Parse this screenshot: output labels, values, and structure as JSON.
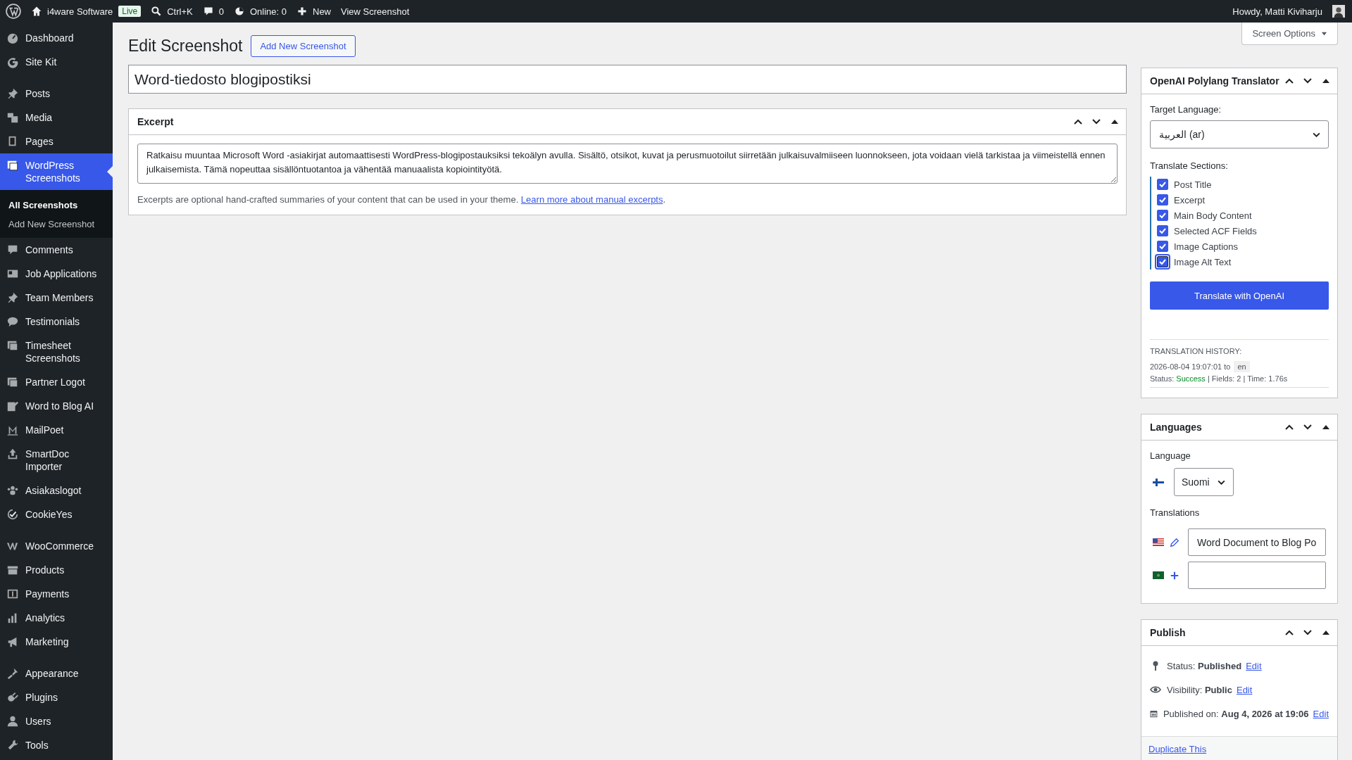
{
  "admin_bar": {
    "site": "i4ware Software",
    "badge": "Live",
    "search": "Ctrl+K",
    "comments": "0",
    "online": "Online: 0",
    "new": "New",
    "view": "View Screenshot",
    "greeting": "Howdy, Matti Kiviharju"
  },
  "sidebar": {
    "groups": [
      [
        {
          "label": "Dashboard",
          "selected": false
        },
        {
          "label": "Site Kit",
          "selected": false
        }
      ],
      [
        {
          "label": "Posts",
          "selected": false
        },
        {
          "label": "Media",
          "selected": false
        },
        {
          "label": "Pages",
          "selected": false
        },
        {
          "label": "WordPress Screenshots",
          "selected": true,
          "children": [
            {
              "label": "All Screenshots",
              "selected": true
            },
            {
              "label": "Add New Screenshot",
              "selected": false
            }
          ]
        },
        {
          "label": "Comments",
          "selected": false
        },
        {
          "label": "Job Applications",
          "selected": false
        },
        {
          "label": "Team Members",
          "selected": false
        },
        {
          "label": "Testimonials",
          "selected": false
        },
        {
          "label": "Timesheet Screenshots",
          "selected": false
        },
        {
          "label": "Partner Logot",
          "selected": false
        },
        {
          "label": "Word to Blog AI",
          "selected": false
        },
        {
          "label": "MailPoet",
          "selected": false
        },
        {
          "label": "SmartDoc Importer",
          "selected": false
        },
        {
          "label": "Asiakaslogot",
          "selected": false
        },
        {
          "label": "CookieYes",
          "selected": false
        }
      ],
      [
        {
          "label": "WooCommerce",
          "selected": false
        },
        {
          "label": "Products",
          "selected": false
        },
        {
          "label": "Payments",
          "selected": false
        },
        {
          "label": "Analytics",
          "selected": false
        },
        {
          "label": "Marketing",
          "selected": false
        }
      ],
      [
        {
          "label": "Appearance",
          "selected": false
        },
        {
          "label": "Plugins",
          "selected": false
        },
        {
          "label": "Users",
          "selected": false
        },
        {
          "label": "Tools",
          "selected": false
        }
      ]
    ]
  },
  "screen_options": "Screen Options",
  "heading": "Edit Screenshot",
  "add_new": "Add New Screenshot",
  "title_field": {
    "value": "Word-tiedosto blogipostiksi"
  },
  "excerpt": {
    "title": "Excerpt",
    "value": "Ratkaisu muuntaa Microsoft Word -asiakirjat automaattisesti WordPress-blogipostauksiksi tekoälyn avulla. Sisältö, otsikot, kuvat ja perusmuotoilut siirretään julkaisuvalmiiseen luonnokseen, jota voidaan vielä tarkistaa ja viimeistellä ennen julkaisemista. Tämä nopeuttaa sisällöntuotantoa ja vähentää manuaalista kopiointityötä.",
    "help": "Excerpts are optional hand-crafted summaries of your content that can be used in your theme.",
    "help_link": "Learn more about manual excerpts",
    "help_end": "."
  },
  "translator": {
    "title": "OpenAI Polylang Translator",
    "target_label": "Target Language:",
    "target_value": "العربية (ar)",
    "sections_label": "Translate Sections:",
    "sections": [
      {
        "label": "Post Title",
        "checked": true,
        "focused": false
      },
      {
        "label": "Excerpt",
        "checked": true,
        "focused": false
      },
      {
        "label": "Main Body Content",
        "checked": true,
        "focused": false
      },
      {
        "label": "Selected ACF Fields",
        "checked": true,
        "focused": false
      },
      {
        "label": "Image Captions",
        "checked": true,
        "focused": false
      },
      {
        "label": "Image Alt Text",
        "checked": true,
        "focused": true
      }
    ],
    "button": "Translate with OpenAI",
    "history_label": "TRANSLATION HISTORY:",
    "history_date": "2026-08-04 19:07:01 to",
    "history_lang": "en",
    "status_prefix": "Status:",
    "status": "Success",
    "status_suffix": "| Fields: 2 | Time: 1.76s"
  },
  "languages": {
    "title": "Languages",
    "language_label": "Language",
    "language_value": "Suomi",
    "translations_label": "Translations",
    "translations": [
      {
        "kind": "edit",
        "value": "Word Document to Blog Po"
      },
      {
        "kind": "add"
      }
    ]
  },
  "publish": {
    "title": "Publish",
    "rows": [
      {
        "kind": "status",
        "text": "Status: **Published**",
        "link": "Edit"
      },
      {
        "kind": "visibility",
        "text": "Visibility: **Public**",
        "link": "Edit"
      },
      {
        "kind": "date",
        "text": "Published on: **Aug 4, 2026 at 19:06**",
        "link": "Edit"
      }
    ],
    "footer_link": "Duplicate This"
  }
}
